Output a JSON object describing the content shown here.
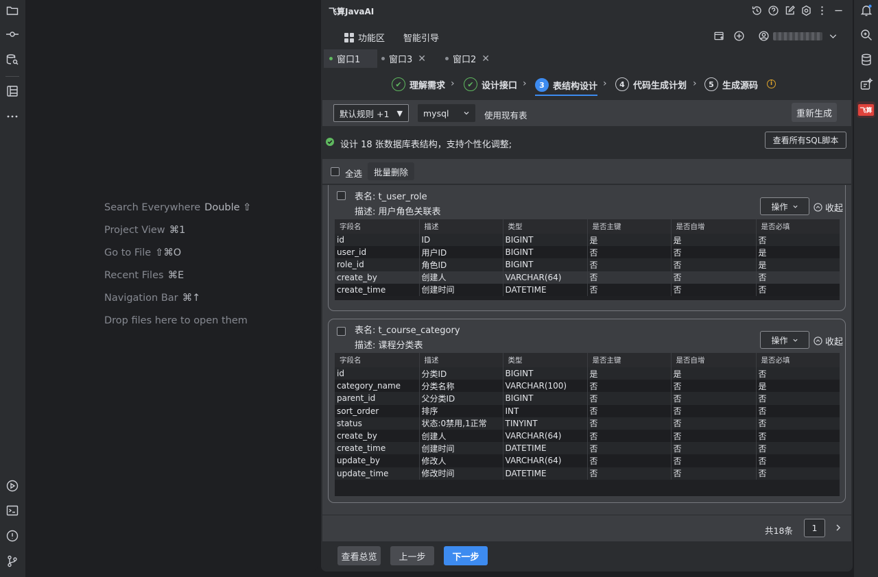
{
  "editor_hints": [
    {
      "label": "Search Everywhere",
      "shortcut": "Double ⇧"
    },
    {
      "label": "Project View",
      "shortcut": "⌘1"
    },
    {
      "label": "Go to File",
      "shortcut": "⇧⌘O"
    },
    {
      "label": "Recent Files",
      "shortcut": "⌘E"
    },
    {
      "label": "Navigation Bar",
      "shortcut": "⌘↑"
    },
    {
      "label": "Drop files here to open them",
      "shortcut": ""
    }
  ],
  "left_toolbar": {
    "top_icons": [
      "folder-icon",
      "commit-icon",
      "database-search-icon",
      "structure-icon",
      "more-icon"
    ],
    "bottom_icons": [
      "run-icon",
      "terminal-icon",
      "problems-icon",
      "git-branch-icon"
    ]
  },
  "right_toolbar": {
    "icons": [
      "notification-icon",
      "ai-chat-icon",
      "database-icon",
      "ai-assistant-icon",
      "feisuan-logo-icon"
    ],
    "logo_text": "飞算"
  },
  "plugin": {
    "title": "飞算JavaAI",
    "nav": {
      "function_area": "功能区",
      "smart_guide": "智能引导"
    },
    "tabs": [
      {
        "label": "窗口1",
        "active": true,
        "closable": false
      },
      {
        "label": "窗口3",
        "active": false,
        "closable": true
      },
      {
        "label": "窗口2",
        "active": false,
        "closable": true
      }
    ],
    "steps": [
      {
        "num": "✔",
        "label": "理解需求",
        "state": "done"
      },
      {
        "num": "✔",
        "label": "设计接口",
        "state": "done"
      },
      {
        "num": "3",
        "label": "表结构设计",
        "state": "current"
      },
      {
        "num": "4",
        "label": "代码生成计划",
        "state": "todo"
      },
      {
        "num": "5",
        "label": "生成源码",
        "state": "todo"
      }
    ],
    "toolbar": {
      "rule_select": "默认规则 +1",
      "db_select": "mysql",
      "use_existing": "使用现有表",
      "regenerate": "重新生成"
    },
    "info": {
      "message": "设计 18 张数据库表结构，支持个性化调整;",
      "view_sql": "查看所有SQL脚本"
    },
    "selection": {
      "select_all": "全选",
      "batch_delete": "批量删除"
    },
    "columns": [
      "字段名",
      "描述",
      "类型",
      "是否主键",
      "是否自增",
      "是否必填"
    ],
    "tables": [
      {
        "name": "表名: t_user_role",
        "desc": "描述: 用户角色关联表",
        "op_label": "操作",
        "collapse_label": "收起",
        "rows": [
          [
            "id",
            "ID",
            "BIGINT",
            "是",
            "是",
            "否"
          ],
          [
            "user_id",
            "用户ID",
            "BIGINT",
            "否",
            "否",
            "是"
          ],
          [
            "role_id",
            "角色ID",
            "BIGINT",
            "否",
            "否",
            "是"
          ],
          [
            "create_by",
            "创建人",
            "VARCHAR(64)",
            "否",
            "否",
            "否"
          ],
          [
            "create_time",
            "创建时间",
            "DATETIME",
            "否",
            "否",
            "否"
          ]
        ]
      },
      {
        "name": "表名: t_course_category",
        "desc": "描述: 课程分类表",
        "op_label": "操作",
        "collapse_label": "收起",
        "rows": [
          [
            "id",
            "分类ID",
            "BIGINT",
            "是",
            "是",
            "否"
          ],
          [
            "category_name",
            "分类名称",
            "VARCHAR(100)",
            "否",
            "否",
            "是"
          ],
          [
            "parent_id",
            "父分类ID",
            "BIGINT",
            "否",
            "否",
            "否"
          ],
          [
            "sort_order",
            "排序",
            "INT",
            "否",
            "否",
            "否"
          ],
          [
            "status",
            "状态:0禁用,1正常",
            "TINYINT",
            "否",
            "否",
            "否"
          ],
          [
            "create_by",
            "创建人",
            "VARCHAR(64)",
            "否",
            "否",
            "否"
          ],
          [
            "create_time",
            "创建时间",
            "DATETIME",
            "否",
            "否",
            "否"
          ],
          [
            "update_by",
            "修改人",
            "VARCHAR(64)",
            "否",
            "否",
            "否"
          ],
          [
            "update_time",
            "修改时间",
            "DATETIME",
            "否",
            "否",
            "否"
          ]
        ]
      }
    ],
    "pager": {
      "total": "共18条",
      "page": "1"
    },
    "footer": {
      "overview": "查看总览",
      "prev": "上一步",
      "next": "下一步"
    },
    "colors": {
      "accent": "#3d8bf0",
      "success": "#5fb85f",
      "warning": "#e0a52a"
    }
  }
}
